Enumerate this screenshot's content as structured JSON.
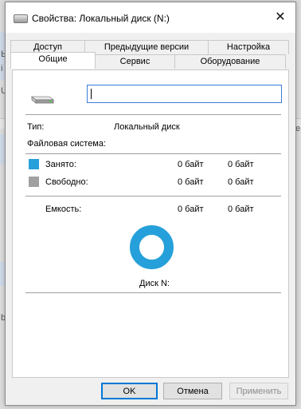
{
  "background": {
    "edge_chars": [
      "Ь",
      "і",
      "U",
      "k",
      "b",
      "e"
    ]
  },
  "dialog": {
    "title": "Свойства: Локальный диск (N:)",
    "close_glyph": "✕"
  },
  "tabs": {
    "row1": [
      {
        "label": "Доступ"
      },
      {
        "label": "Предыдущие версии"
      },
      {
        "label": "Настройка"
      }
    ],
    "row2": [
      {
        "label": "Общие",
        "active": true
      },
      {
        "label": "Сервис"
      },
      {
        "label": "Оборудование"
      }
    ]
  },
  "general": {
    "name_value": "",
    "type_label": "Тип:",
    "type_value": "Локальный диск",
    "fs_label": "Файловая система:",
    "fs_value": "",
    "used_label": "Занято:",
    "used_bytes": "0 байт",
    "used_size": "0 байт",
    "used_color": "#26a0da",
    "free_label": "Свободно:",
    "free_bytes": "0 байт",
    "free_size": "0 байт",
    "free_color": "#a0a0a0",
    "capacity_label": "Емкость:",
    "capacity_bytes": "0 байт",
    "capacity_size": "0 байт",
    "disk_caption": "Диск N:"
  },
  "buttons": {
    "ok": "OK",
    "cancel": "Отмена",
    "apply": "Применить"
  }
}
